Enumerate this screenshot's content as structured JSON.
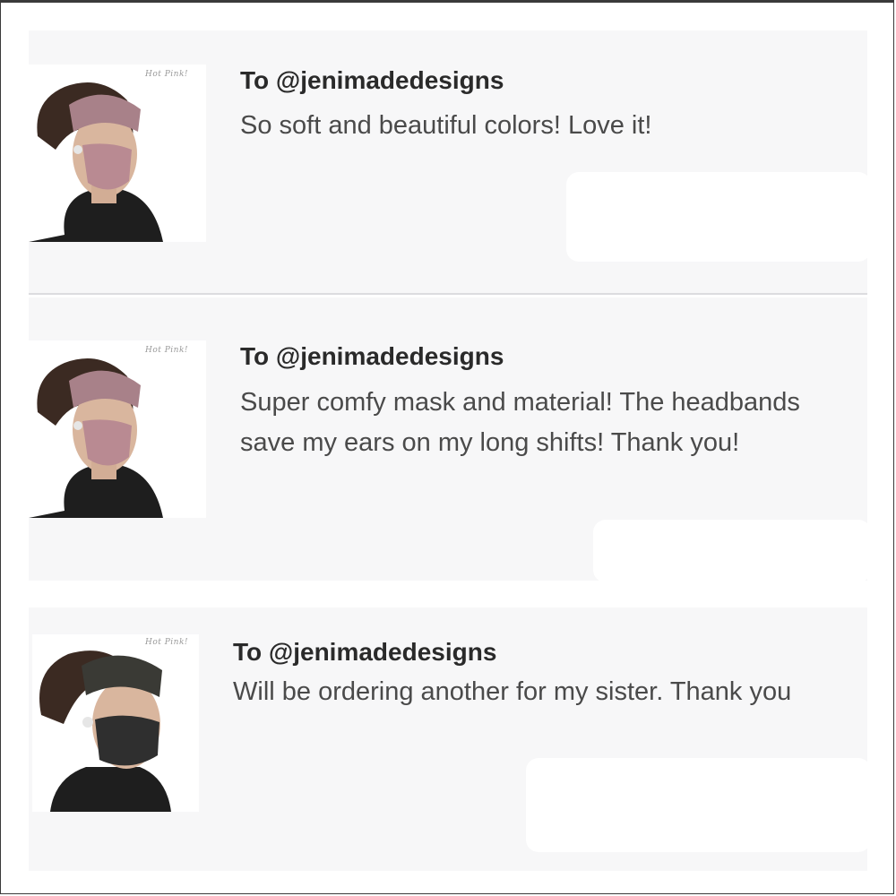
{
  "reviews": [
    {
      "recipient": "To @jenimadedesigns",
      "message": "So soft and beautiful colors! Love it!",
      "product_image": "woman-wearing-pink-camo-headband-and-mask",
      "mask_color": "#b98a92",
      "headband_color": "#a88189"
    },
    {
      "recipient": "To @jenimadedesigns",
      "message": "Super comfy mask and material! The headbands save my ears on my long shifts! Thank you!",
      "product_image": "woman-wearing-pink-camo-headband-and-mask",
      "mask_color": "#b98a92",
      "headband_color": "#a88189"
    },
    {
      "recipient": "To @jenimadedesigns",
      "message": "Will be ordering another for my sister. Thank you",
      "product_image": "woman-wearing-dark-camo-headband-and-mask",
      "mask_color": "#2f2f2f",
      "headband_color": "#3a3a35"
    }
  ],
  "colors": {
    "card_background": "#f7f7f8",
    "text_primary": "#2a2a2a",
    "text_secondary": "#4a4a4a"
  }
}
